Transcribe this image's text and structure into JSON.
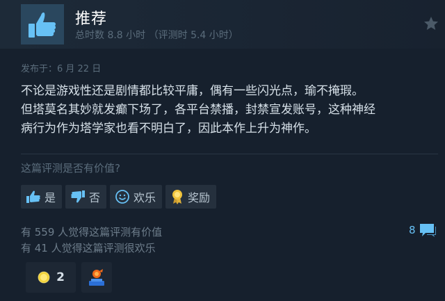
{
  "review": {
    "verdict": "推荐",
    "hours": "总时数 8.8 小时 （评测时 5.4 小时）",
    "posted": "发布于：6 月 22 日",
    "text_lines": [
      "不论是游戏性还是剧情都比较平庸，偶有一些闪光点，瑜不掩瑕。",
      "但塔莫名其妙就发癫下场了，各平台禁播，封禁宣发账号，这种神经",
      "病行为作为塔学家也看不明白了，因此本作上升为神作。"
    ]
  },
  "feedback": {
    "question": "这篇评测是否有价值?",
    "yes_label": "是",
    "no_label": "否",
    "funny_label": "欢乐",
    "award_label": "奖励"
  },
  "stats": {
    "helpful_text": "有 559 人觉得这篇评测有价值",
    "funny_text": "有 41 人觉得这篇评测很欢乐",
    "comment_count": "8"
  },
  "awards": [
    {
      "icon": "gold-coin-icon",
      "count": "2"
    },
    {
      "icon": "trophy-award-icon",
      "count": ""
    }
  ],
  "colors": {
    "background": "#16202d",
    "header": "#1d2a38",
    "accent": "#66c0f4",
    "thumb_box": "#2a475e"
  }
}
